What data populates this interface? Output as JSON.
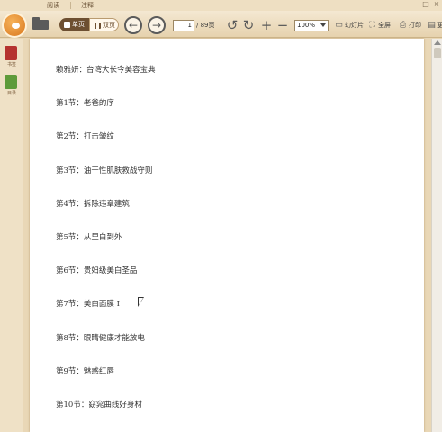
{
  "tabs": {
    "read": "阅读",
    "note": "注释"
  },
  "window_controls": {
    "minimize": "−",
    "restore": "□",
    "close": "×"
  },
  "toolbar": {
    "single_page": "单页",
    "double_page": "双页",
    "prev_icon": "←",
    "next_icon": "→",
    "current_page": "1",
    "total_pages": "/ 89页",
    "rotate_left_icon": "↺",
    "rotate_right_icon": "↻",
    "zoom_in_icon": "+",
    "zoom_out_icon": "−",
    "zoom_level": "100%",
    "slideshow": "幻灯片",
    "fullscreen": "全屏",
    "print": "打印",
    "more": "更"
  },
  "sidebar": {
    "items": [
      {
        "label": "书签",
        "icon": "bookmark-icon"
      },
      {
        "label": "目录",
        "icon": "toc-icon"
      }
    ]
  },
  "document": {
    "lines": [
      "赖雅妍：台湾大长今美容宝典",
      "第1节：老爸的序",
      "第2节：打击皱纹",
      "第3节：油干性肌肤救战守则",
      "第4节：拆除违章建筑",
      "第5节：从里白到外",
      "第6节：贵妇级美白圣品",
      "第7节：美白面膜 I",
      "第8节：眼睛健康才能放电",
      "第9节：魅惑红唇",
      "第10节：窈窕曲线好身材"
    ]
  }
}
